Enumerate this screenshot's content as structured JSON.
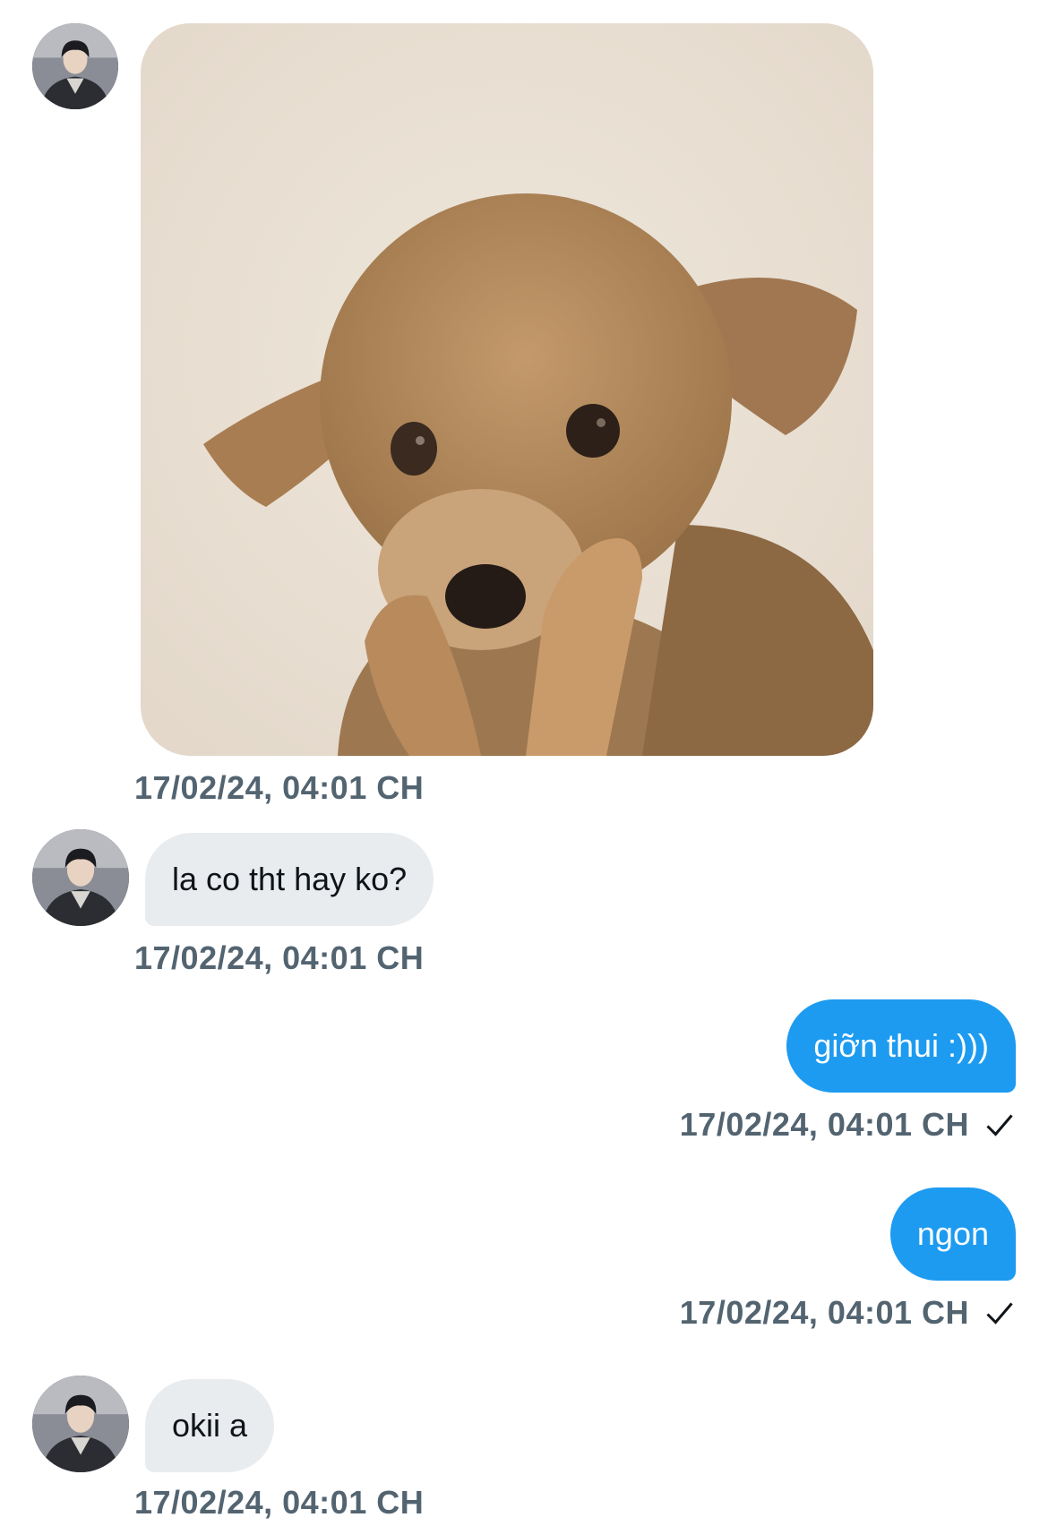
{
  "conversation": {
    "messages": [
      {
        "direction": "incoming",
        "kind": "image",
        "image_icon": "puppy-photo",
        "timestamp": "17/02/24, 04:01 CH"
      },
      {
        "direction": "incoming",
        "kind": "text",
        "text": "la co tht hay ko?",
        "timestamp": "17/02/24, 04:01 CH"
      },
      {
        "direction": "outgoing",
        "kind": "text",
        "text": "giỡn thui :)))",
        "timestamp": "17/02/24, 04:01 CH",
        "status_icon": "checkmark-icon"
      },
      {
        "direction": "outgoing",
        "kind": "text",
        "text": "ngon",
        "timestamp": "17/02/24, 04:01 CH",
        "status_icon": "checkmark-icon"
      },
      {
        "direction": "incoming",
        "kind": "text",
        "text": "okii a",
        "timestamp": "17/02/24, 04:01 CH"
      }
    ]
  },
  "colors": {
    "incoming_bubble": "#e9ecef",
    "outgoing_bubble": "#1d9bf0",
    "timestamp": "#536471",
    "text": "#0f1419"
  }
}
